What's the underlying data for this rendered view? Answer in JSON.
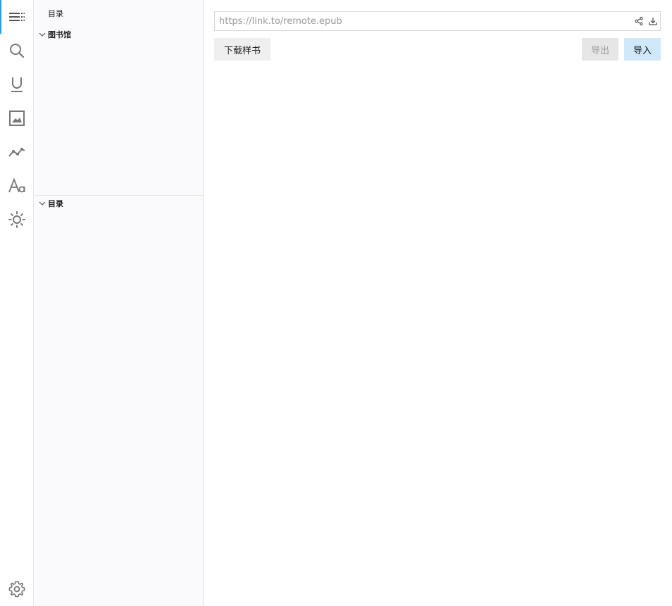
{
  "activity_bar": {
    "items": [
      {
        "icon": "toc-list-icon",
        "active": true
      },
      {
        "icon": "search-icon",
        "active": false
      },
      {
        "icon": "underline-icon",
        "active": false
      },
      {
        "icon": "image-icon",
        "active": false
      },
      {
        "icon": "trend-line-icon",
        "active": false
      },
      {
        "icon": "font-icon",
        "active": false
      },
      {
        "icon": "sun-icon",
        "active": false
      }
    ],
    "bottom_item": {
      "icon": "gear-icon"
    }
  },
  "sidebar": {
    "title": "目录",
    "sections": [
      {
        "label": "图书馆",
        "expanded": true
      },
      {
        "label": "目录",
        "expanded": true
      }
    ]
  },
  "main": {
    "url_input": {
      "value": "",
      "placeholder": "https://link.to/remote.epub"
    },
    "buttons": {
      "sample": "下载样书",
      "export": "导出",
      "import": "导入"
    }
  },
  "colors": {
    "accent": "#2d9cf0",
    "import_bg": "#cfe9fb",
    "sidebar_bg": "#fafafd"
  }
}
